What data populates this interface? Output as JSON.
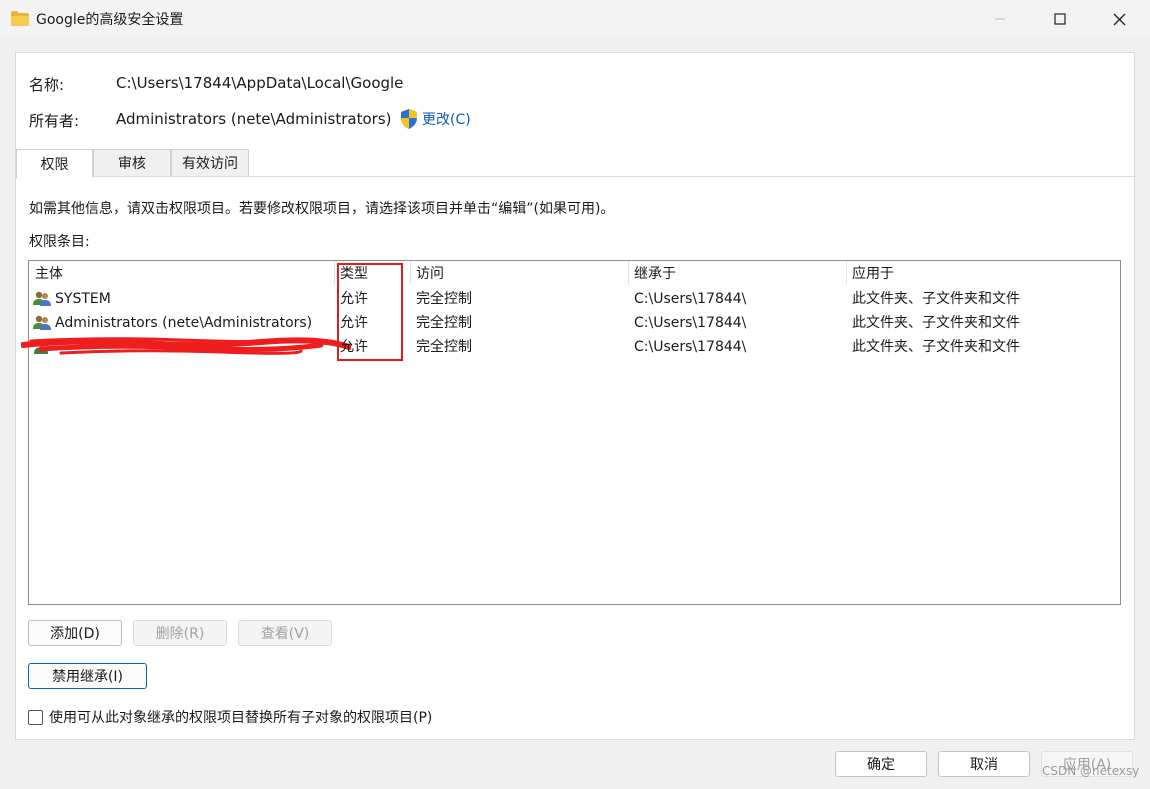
{
  "window": {
    "title": "Google的高级安全设置",
    "folder_icon": "folder-icon",
    "controls": {
      "minimize": "minimize-icon",
      "maximize": "maximize-icon",
      "close": "close-icon"
    }
  },
  "info": {
    "name_label": "名称:",
    "name_value": "C:\\Users\\17844\\AppData\\Local\\Google",
    "owner_label": "所有者:",
    "owner_value": "Administrators (nete\\Administrators)",
    "change_link": "更改(C)"
  },
  "tabs": [
    {
      "label": "权限",
      "active": true
    },
    {
      "label": "审核",
      "active": false
    },
    {
      "label": "有效访问",
      "active": false
    }
  ],
  "hint": "如需其他信息，请双击权限项目。若要修改权限项目，请选择该项目并单击“编辑”(如果可用)。",
  "entries_label": "权限条目:",
  "columns": [
    "主体",
    "类型",
    "访问",
    "继承于",
    "应用于"
  ],
  "rows": [
    {
      "principal": "SYSTEM",
      "type": "允许",
      "access": "完全控制",
      "inherited": "C:\\Users\\17844\\",
      "applies": "此文件夹、子文件夹和文件"
    },
    {
      "principal": "Administrators (nete\\Administrators)",
      "type": "允许",
      "access": "完全控制",
      "inherited": "C:\\Users\\17844\\",
      "applies": "此文件夹、子文件夹和文件"
    },
    {
      "principal": "",
      "type": "允许",
      "access": "完全控制",
      "inherited": "C:\\Users\\17844\\",
      "applies": "此文件夹、子文件夹和文件"
    }
  ],
  "buttons": {
    "add": "添加(D)",
    "remove": "删除(R)",
    "view": "查看(V)",
    "disable_inherit": "禁用继承(I)"
  },
  "checkbox_label": "使用可从此对象继承的权限项目替换所有子对象的权限项目(P)",
  "footer": {
    "ok": "确定",
    "cancel": "取消",
    "apply": "应用(A)"
  },
  "watermark": "CSDN @netexsy",
  "colors": {
    "highlight_box": "#e21b1b",
    "link": "#0a5bbf",
    "primary_border": "#0067c0"
  }
}
